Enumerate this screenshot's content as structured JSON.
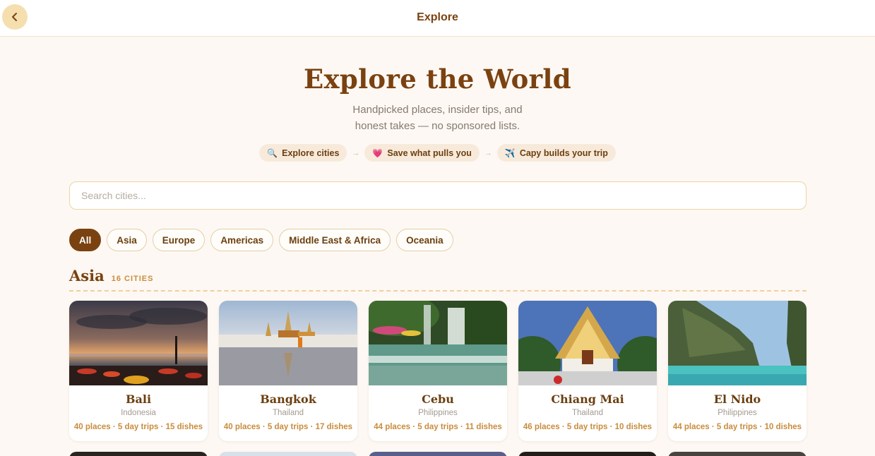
{
  "header": {
    "title": "Explore",
    "back_icon": "chevron-left-icon"
  },
  "hero": {
    "title": "Explore the World",
    "subtitle_line1": "Handpicked places, insider tips, and",
    "subtitle_line2": "honest takes — no sponsored lists."
  },
  "steps": [
    {
      "icon": "🔍",
      "icon_name": "magnifier-icon",
      "label": "Explore cities"
    },
    {
      "icon": "💗",
      "icon_name": "heart-icon",
      "label": "Save what pulls you"
    },
    {
      "icon": "✈️",
      "icon_name": "airplane-icon",
      "label": "Capy builds your trip"
    }
  ],
  "step_separator": "→",
  "search": {
    "placeholder": "Search cities...",
    "value": ""
  },
  "filters": [
    "All",
    "Asia",
    "Europe",
    "Americas",
    "Middle East & Africa",
    "Oceania"
  ],
  "active_filter": "All",
  "section": {
    "title": "Asia",
    "count": "16 CITIES"
  },
  "cities": [
    {
      "name": "Bali",
      "country": "Indonesia",
      "stats": "40 places · 5 day trips · 15 dishes"
    },
    {
      "name": "Bangkok",
      "country": "Thailand",
      "stats": "40 places · 5 day trips · 17 dishes"
    },
    {
      "name": "Cebu",
      "country": "Philippines",
      "stats": "44 places · 5 day trips · 11 dishes"
    },
    {
      "name": "Chiang Mai",
      "country": "Thailand",
      "stats": "46 places · 5 day trips · 10 dishes"
    },
    {
      "name": "El Nido",
      "country": "Philippines",
      "stats": "44 places · 5 day trips · 10 dishes"
    }
  ],
  "colors": {
    "accent": "#7a4210",
    "background": "#fdf8f3",
    "highlight": "#c98c3d"
  }
}
